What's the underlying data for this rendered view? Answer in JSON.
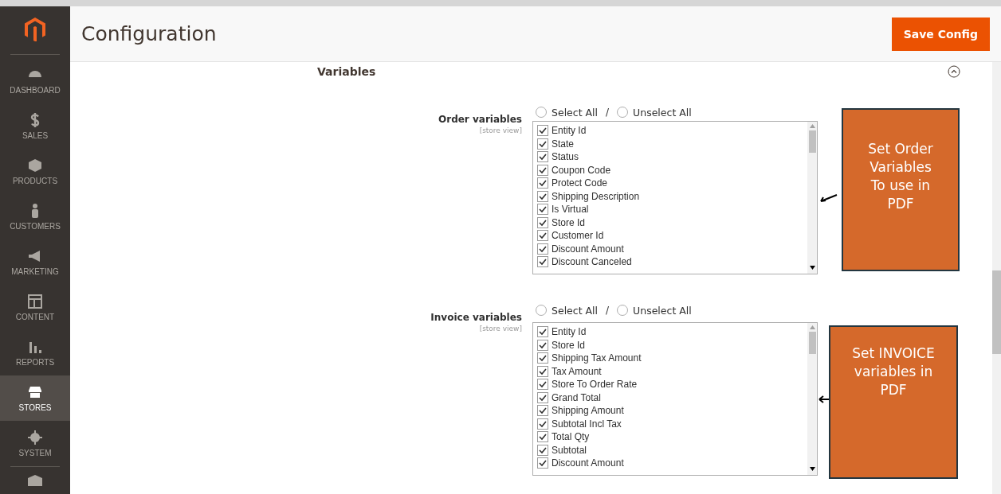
{
  "sidebar": {
    "items": [
      {
        "label": "DASHBOARD",
        "selected": false
      },
      {
        "label": "SALES",
        "selected": false
      },
      {
        "label": "PRODUCTS",
        "selected": false
      },
      {
        "label": "CUSTOMERS",
        "selected": false
      },
      {
        "label": "MARKETING",
        "selected": false
      },
      {
        "label": "CONTENT",
        "selected": false
      },
      {
        "label": "REPORTS",
        "selected": false
      },
      {
        "label": "STORES",
        "selected": true
      },
      {
        "label": "SYSTEM",
        "selected": false
      }
    ]
  },
  "header": {
    "title": "Configuration",
    "save_button": "Save Config"
  },
  "section": {
    "title": "Variables",
    "expanded": true
  },
  "fields": [
    {
      "label": "Order variables",
      "scope": "[store view]",
      "select_all": {
        "label": "Select All",
        "selected": false
      },
      "separator": "/",
      "unselect_all": {
        "label": "Unselect All",
        "selected": false
      },
      "note": "Set Order Variables To use in PDF",
      "items": [
        {
          "label": "Entity Id",
          "checked": true
        },
        {
          "label": "State",
          "checked": true
        },
        {
          "label": "Status",
          "checked": true
        },
        {
          "label": "Coupon Code",
          "checked": true
        },
        {
          "label": "Protect Code",
          "checked": true
        },
        {
          "label": "Shipping Description",
          "checked": true
        },
        {
          "label": "Is Virtual",
          "checked": true
        },
        {
          "label": "Store Id",
          "checked": true
        },
        {
          "label": "Customer Id",
          "checked": true
        },
        {
          "label": "Discount Amount",
          "checked": true
        },
        {
          "label": "Discount Canceled",
          "checked": true
        }
      ]
    },
    {
      "label": "Invoice variables",
      "scope": "[store view]",
      "select_all": {
        "label": "Select All",
        "selected": false
      },
      "separator": "/",
      "unselect_all": {
        "label": "Unselect All",
        "selected": false
      },
      "note": "Set INVOICE variables in PDF",
      "items": [
        {
          "label": "Entity Id",
          "checked": true
        },
        {
          "label": "Store Id",
          "checked": true
        },
        {
          "label": "Shipping Tax Amount",
          "checked": true
        },
        {
          "label": "Tax Amount",
          "checked": true
        },
        {
          "label": "Store To Order Rate",
          "checked": true
        },
        {
          "label": "Grand Total",
          "checked": true
        },
        {
          "label": "Shipping Amount",
          "checked": true
        },
        {
          "label": "Subtotal Incl Tax",
          "checked": true
        },
        {
          "label": "Total Qty",
          "checked": true
        },
        {
          "label": "Subtotal",
          "checked": true
        },
        {
          "label": "Discount Amount",
          "checked": true
        }
      ]
    }
  ]
}
